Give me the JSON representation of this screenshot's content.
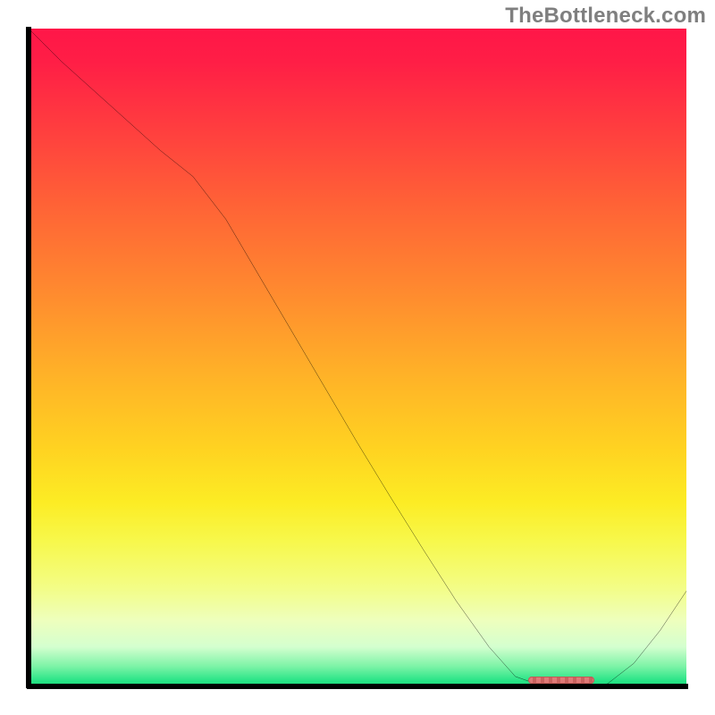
{
  "watermark": "TheBottleneck.com",
  "chart_data": {
    "type": "line",
    "title": "",
    "xlabel": "",
    "ylabel": "",
    "xlim": [
      0,
      100
    ],
    "ylim": [
      0,
      100
    ],
    "grid": false,
    "legend": false,
    "series": [
      {
        "name": "curve",
        "color": "#000000",
        "x": [
          0,
          5,
          10,
          15,
          20,
          25,
          30,
          35,
          40,
          45,
          50,
          55,
          60,
          65,
          70,
          74,
          78,
          82,
          85,
          88,
          92,
          96,
          100
        ],
        "y": [
          100,
          95,
          90.5,
          86,
          81.5,
          77.5,
          71,
          62.5,
          54,
          45.5,
          37,
          28.8,
          20.8,
          13,
          6,
          1.5,
          0.1,
          0.0,
          0.0,
          0.4,
          3.5,
          8.5,
          14.5
        ]
      }
    ],
    "highlight_band": {
      "x_start": 76,
      "x_end": 86,
      "y": 0.5,
      "color": "#d76d6b"
    },
    "background_gradient": {
      "direction": "vertical",
      "stops": [
        {
          "pos": 0.0,
          "color": "#ff1648"
        },
        {
          "pos": 0.3,
          "color": "#ff6f34"
        },
        {
          "pos": 0.62,
          "color": "#ffcf22"
        },
        {
          "pos": 0.8,
          "color": "#f6fc5f"
        },
        {
          "pos": 0.94,
          "color": "#c9ffce"
        },
        {
          "pos": 1.0,
          "color": "#15d978"
        }
      ]
    }
  }
}
